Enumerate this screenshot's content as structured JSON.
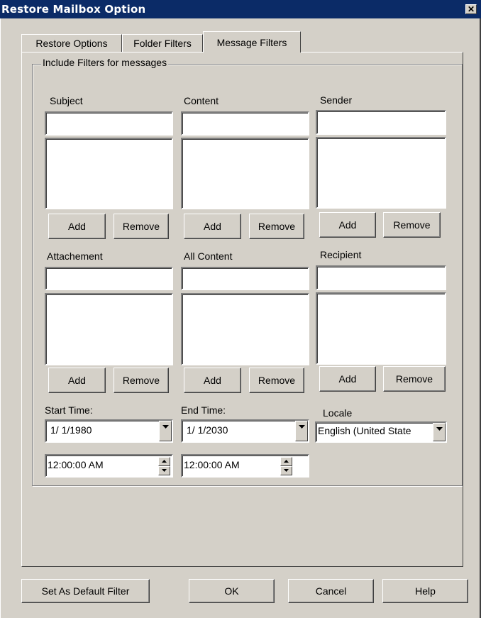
{
  "window": {
    "title": "Restore Mailbox Option",
    "close_glyph": "✕"
  },
  "tabs": [
    {
      "label": "Restore Options",
      "active": false
    },
    {
      "label": "Folder Filters",
      "active": false
    },
    {
      "label": "Message Filters",
      "active": true
    }
  ],
  "group": {
    "legend": "Include Filters for messages"
  },
  "filters": {
    "subject": {
      "label": "Subject",
      "input_value": "",
      "list": [],
      "add": "Add",
      "remove": "Remove"
    },
    "content": {
      "label": "Content",
      "input_value": "",
      "list": [],
      "add": "Add",
      "remove": "Remove"
    },
    "sender": {
      "label": "Sender",
      "input_value": "",
      "list": [],
      "add": "Add",
      "remove": "Remove"
    },
    "attachment": {
      "label": "Attachement",
      "input_value": "",
      "list": [],
      "add": "Add",
      "remove": "Remove"
    },
    "all_content": {
      "label": "All Content",
      "input_value": "",
      "list": [],
      "add": "Add",
      "remove": "Remove"
    },
    "recipient": {
      "label": "Recipient",
      "input_value": "",
      "list": [],
      "add": "Add",
      "remove": "Remove"
    }
  },
  "start": {
    "label": "Start Time:",
    "date": "1/ 1/1980",
    "time": "12:00:00 AM"
  },
  "end": {
    "label": "End Time:",
    "date": "1/ 1/2030",
    "time": "12:00:00 AM"
  },
  "locale": {
    "label": "Locale",
    "value": "English (United State"
  },
  "footer": {
    "set_default": "Set As Default Filter",
    "ok": "OK",
    "cancel": "Cancel",
    "help": "Help"
  }
}
